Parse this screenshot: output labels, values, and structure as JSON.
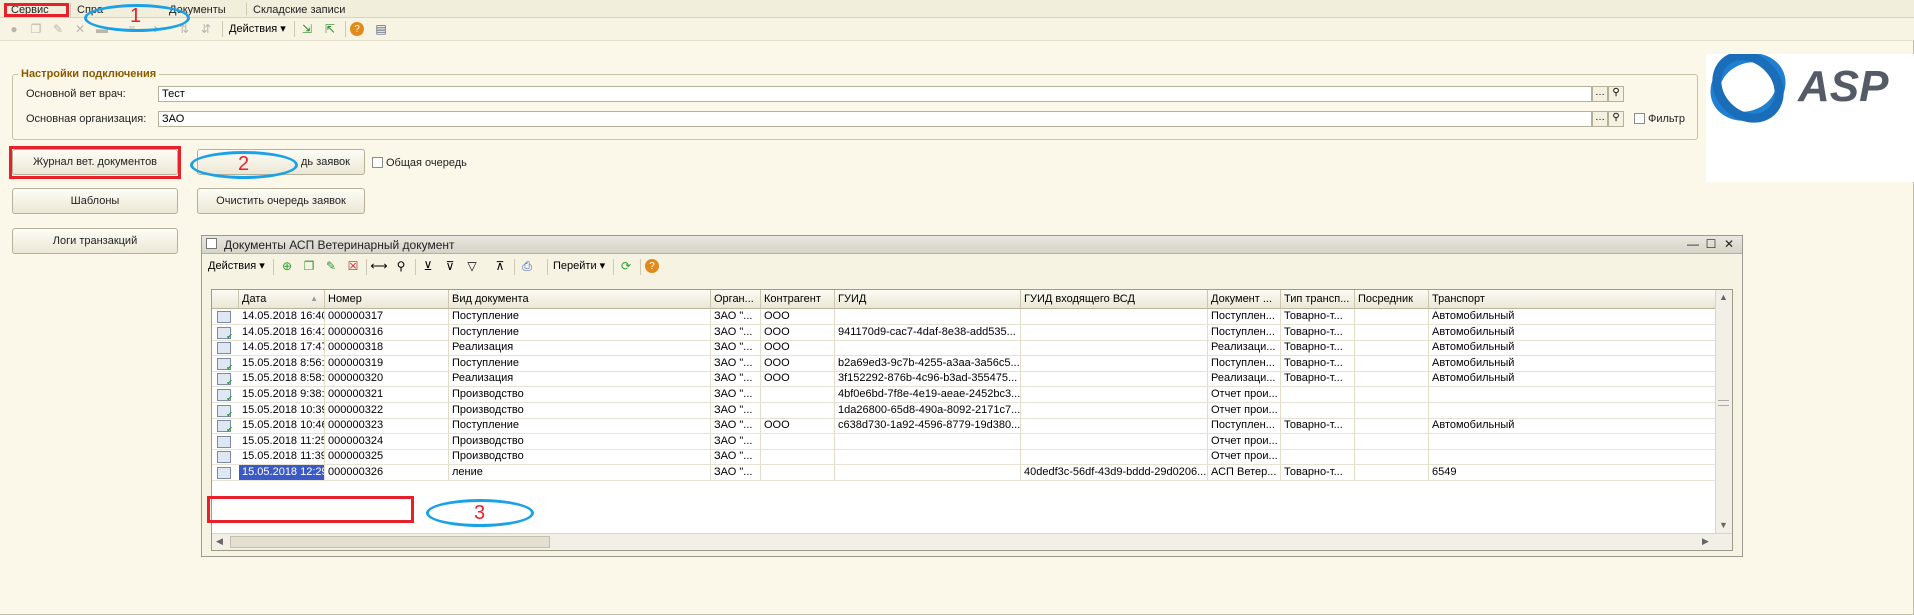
{
  "menu": {
    "items": [
      "Сервис",
      "Спра",
      "Документы",
      "Складские записи"
    ]
  },
  "toolbar": {
    "actions_label": "Действия ▾",
    "icons": [
      "circle-icon",
      "copy-icon",
      "edit-icon",
      "delete-icon",
      "folder-icon",
      "list-icon",
      "arrow-icon",
      "sort-asc-icon",
      "sort-desc-icon",
      "export-icon",
      "import-icon",
      "help-icon",
      "settings-icon"
    ]
  },
  "settings": {
    "title": "Настройки подключения",
    "vet_label": "Основной вет врач:",
    "vet_value": "Тест",
    "org_label": "Основная организация:",
    "org_value": "ЗАО",
    "filter_label": "Фильтр"
  },
  "buttons": {
    "journal": "Журнал вет. документов",
    "queue": "дь заявок",
    "shared_queue": "Общая очередь",
    "templates": "Шаблоны",
    "clear_queue": "Очистить очередь заявок",
    "logs": "Логи транзакций"
  },
  "logo": {
    "text": "ASP"
  },
  "window": {
    "title": "Документы АСП Ветеринарный документ",
    "actions_label": "Действия ▾",
    "goto_label": "Перейти ▾"
  },
  "grid": {
    "columns": [
      "Дата",
      "Номер",
      "Вид документа",
      "Орган...",
      "Контрагент",
      "ГУИД",
      "ГУИД входящего ВСД",
      "Документ ...",
      "Тип трансп...",
      "Посредник",
      "Транспорт"
    ],
    "rows": [
      {
        "ok": false,
        "date": "14.05.2018 16:40:...",
        "num": "000000317",
        "kind": "Поступление",
        "org": "ЗАО \"...",
        "contr": "ООО",
        "guid": "",
        "in_guid": "",
        "doc": "Поступлен...",
        "ttype": "Товарно-т...",
        "med": "",
        "trans": "Автомобильный"
      },
      {
        "ok": true,
        "date": "14.05.2018 16:41:...",
        "num": "000000316",
        "kind": "Поступление",
        "org": "ЗАО \"...",
        "contr": "ООО",
        "guid": "941170d9-cac7-4daf-8e38-add535...",
        "in_guid": "",
        "doc": "Поступлен...",
        "ttype": "Товарно-т...",
        "med": "",
        "trans": "Автомобильный"
      },
      {
        "ok": false,
        "date": "14.05.2018 17:47:...",
        "num": "000000318",
        "kind": "Реализация",
        "org": "ЗАО \"...",
        "contr": "ООО",
        "guid": "",
        "in_guid": "",
        "doc": "Реализаци...",
        "ttype": "Товарно-т...",
        "med": "",
        "trans": "Автомобильный"
      },
      {
        "ok": true,
        "date": "15.05.2018 8:56:36",
        "num": "000000319",
        "kind": "Поступление",
        "org": "ЗАО \"...",
        "contr": "ООО",
        "guid": "b2a69ed3-9c7b-4255-a3aa-3a56c5...",
        "in_guid": "",
        "doc": "Поступлен...",
        "ttype": "Товарно-т...",
        "med": "",
        "trans": "Автомобильный"
      },
      {
        "ok": true,
        "date": "15.05.2018 8:58:25",
        "num": "000000320",
        "kind": "Реализация",
        "org": "ЗАО \"...",
        "contr": "ООО",
        "guid": "3f152292-876b-4c96-b3ad-355475...",
        "in_guid": "",
        "doc": "Реализаци...",
        "ttype": "Товарно-т...",
        "med": "",
        "trans": "Автомобильный"
      },
      {
        "ok": true,
        "date": "15.05.2018 9:38:46",
        "num": "000000321",
        "kind": "Производство",
        "org": "ЗАО \"...",
        "contr": "",
        "guid": "4bf0e6bd-7f8e-4e19-aeae-2452bc3...",
        "in_guid": "",
        "doc": "Отчет прои...",
        "ttype": "",
        "med": "",
        "trans": ""
      },
      {
        "ok": true,
        "date": "15.05.2018 10:39:...",
        "num": "000000322",
        "kind": "Производство",
        "org": "ЗАО \"...",
        "contr": "",
        "guid": "1da26800-65d8-490a-8092-2171c7...",
        "in_guid": "",
        "doc": "Отчет прои...",
        "ttype": "",
        "med": "",
        "trans": ""
      },
      {
        "ok": true,
        "date": "15.05.2018 10:46:...",
        "num": "000000323",
        "kind": "Поступление",
        "org": "ЗАО \"...",
        "contr": "ООО",
        "guid": "c638d730-1a92-4596-8779-19d380...",
        "in_guid": "",
        "doc": "Поступлен...",
        "ttype": "Товарно-т...",
        "med": "",
        "trans": "Автомобильный"
      },
      {
        "ok": false,
        "date": "15.05.2018 11:25:...",
        "num": "000000324",
        "kind": "Производство",
        "org": "ЗАО \"...",
        "contr": "",
        "guid": "",
        "in_guid": "",
        "doc": "Отчет прои...",
        "ttype": "",
        "med": "",
        "trans": ""
      },
      {
        "ok": false,
        "date": "15.05.2018 11:39:...",
        "num": "000000325",
        "kind": "Производство",
        "org": "ЗАО \"...",
        "contr": "",
        "guid": "",
        "in_guid": "",
        "doc": "Отчет прои...",
        "ttype": "",
        "med": "",
        "trans": ""
      },
      {
        "ok": false,
        "date": "15.05.2018 12:29:...",
        "num": "000000326",
        "kind": "ление",
        "org": "ЗАО \"...",
        "contr": "",
        "guid": "",
        "in_guid": "40dedf3c-56df-43d9-bddd-29d0206...",
        "doc": "АСП Ветер...",
        "ttype": "Товарно-т...",
        "med": "",
        "trans": "6549"
      }
    ]
  },
  "annotations": {
    "n1": "1",
    "n2": "2",
    "n3": "3",
    "rect_color": "#e8202a",
    "ellipse_color": "#1aa1e6"
  }
}
